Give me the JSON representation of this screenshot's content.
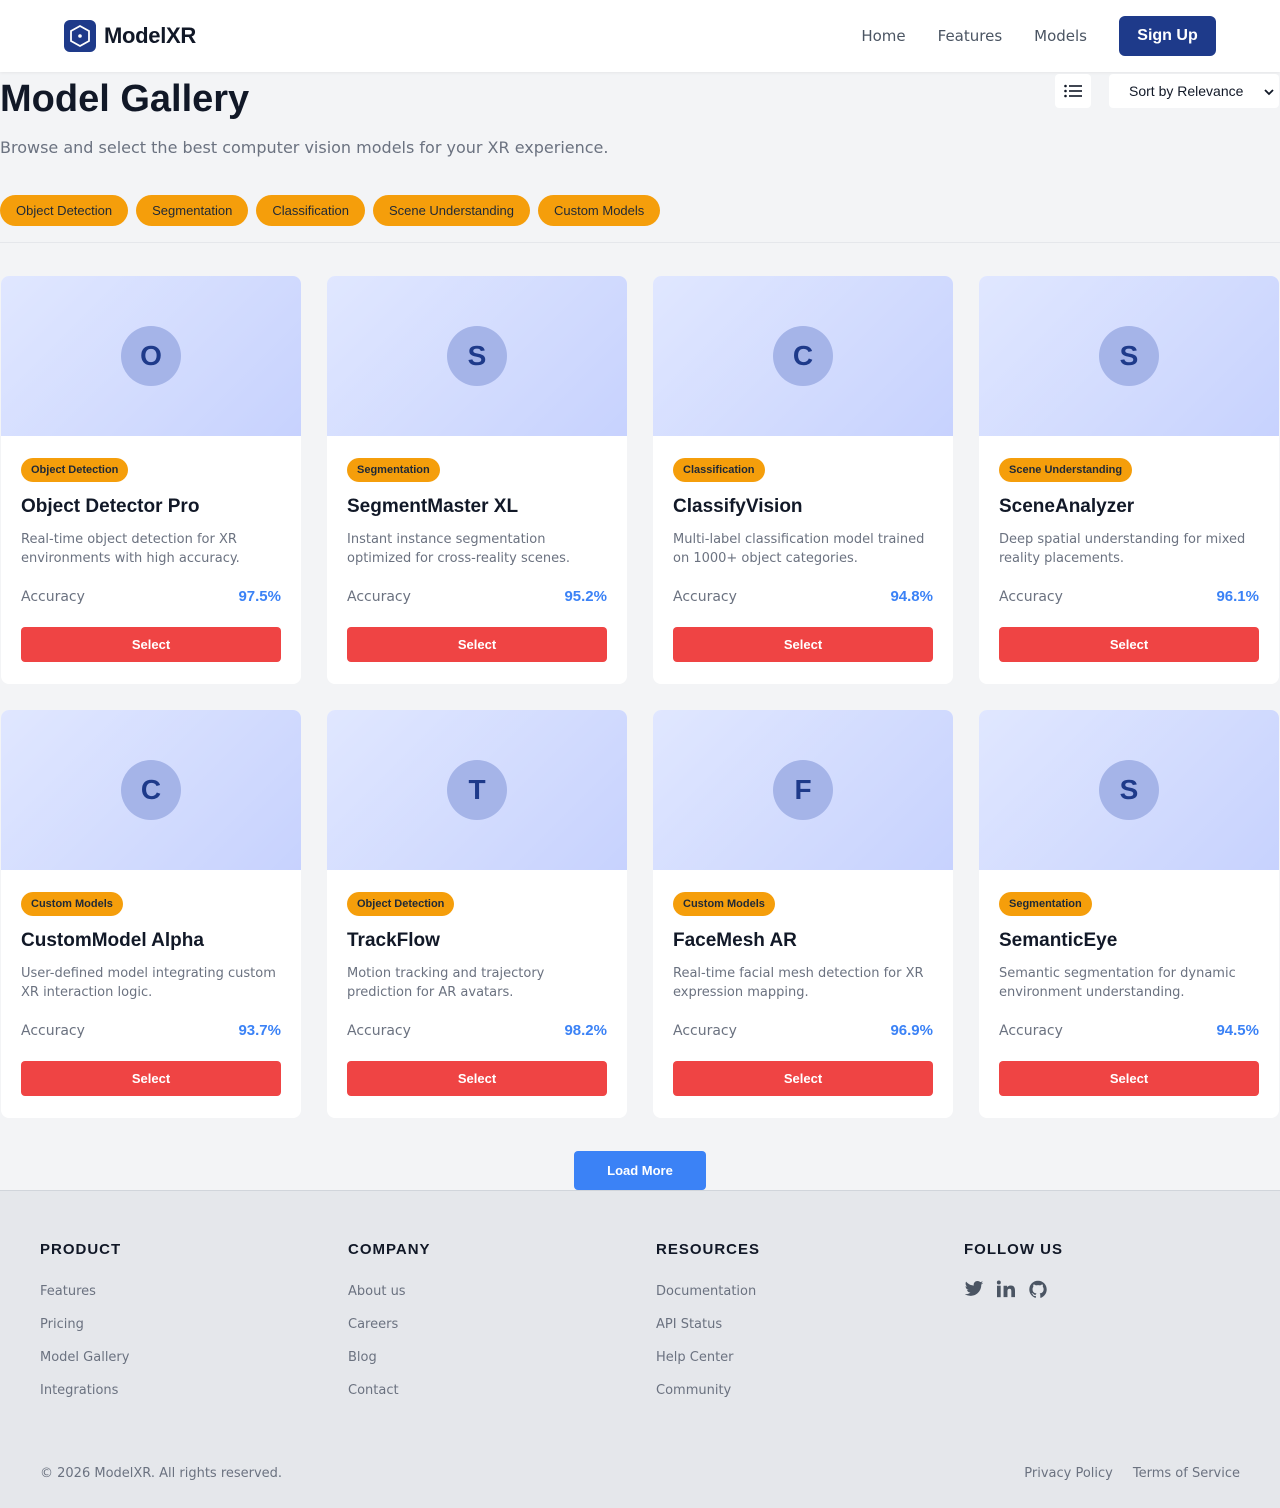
{
  "brand": {
    "name": "ModelXR",
    "logo_icon": "hexagon-logo-icon"
  },
  "nav": {
    "links": [
      "Home",
      "Features",
      "Models"
    ],
    "signup_label": "Sign Up"
  },
  "page": {
    "title": "Model Gallery",
    "subtitle": "Browse and select the best computer vision models for your XR experience.",
    "sort_label": "Sort by Relevance",
    "view_icon": "list-view-icon"
  },
  "filters": [
    "Object Detection",
    "Segmentation",
    "Classification",
    "Scene Understanding",
    "Custom Models"
  ],
  "accuracy_label": "Accuracy",
  "select_label": "Select",
  "models": [
    {
      "initial": "O",
      "category": "Object Detection",
      "name": "Object Detector Pro",
      "description": "Real-time object detection for XR environments with high accuracy.",
      "accuracy": "97.5%"
    },
    {
      "initial": "S",
      "category": "Segmentation",
      "name": "SegmentMaster XL",
      "description": "Instant instance segmentation optimized for cross-reality scenes.",
      "accuracy": "95.2%"
    },
    {
      "initial": "C",
      "category": "Classification",
      "name": "ClassifyVision",
      "description": "Multi-label classification model trained on 1000+ object categories.",
      "accuracy": "94.8%"
    },
    {
      "initial": "S",
      "category": "Scene Understanding",
      "name": "SceneAnalyzer",
      "description": "Deep spatial understanding for mixed reality placements.",
      "accuracy": "96.1%"
    },
    {
      "initial": "C",
      "category": "Custom Models",
      "name": "CustomModel Alpha",
      "description": "User-defined model integrating custom XR interaction logic.",
      "accuracy": "93.7%"
    },
    {
      "initial": "T",
      "category": "Object Detection",
      "name": "TrackFlow",
      "description": "Motion tracking and trajectory prediction for AR avatars.",
      "accuracy": "98.2%"
    },
    {
      "initial": "F",
      "category": "Custom Models",
      "name": "FaceMesh AR",
      "description": "Real-time facial mesh detection for XR expression mapping.",
      "accuracy": "96.9%"
    },
    {
      "initial": "S",
      "category": "Segmentation",
      "name": "SemanticEye",
      "description": "Semantic segmentation for dynamic environment understanding.",
      "accuracy": "94.5%"
    }
  ],
  "load_more_label": "Load More",
  "footer": {
    "columns": [
      {
        "heading": "PRODUCT",
        "links": [
          "Features",
          "Pricing",
          "Model Gallery",
          "Integrations"
        ]
      },
      {
        "heading": "COMPANY",
        "links": [
          "About us",
          "Careers",
          "Blog",
          "Contact"
        ]
      },
      {
        "heading": "RESOURCES",
        "links": [
          "Documentation",
          "API Status",
          "Help Center",
          "Community"
        ]
      }
    ],
    "follow_heading": "FOLLOW US",
    "social_icons": [
      "twitter-icon",
      "linkedin-icon",
      "github-icon"
    ],
    "copyright": "© 2026 ModelXR. All rights reserved.",
    "legal": [
      "Privacy Policy",
      "Terms of Service"
    ]
  },
  "colors": {
    "brand": "#1e3a8a",
    "chip": "#f59e0b",
    "select_button": "#ef4444",
    "accent": "#3b82f6"
  }
}
